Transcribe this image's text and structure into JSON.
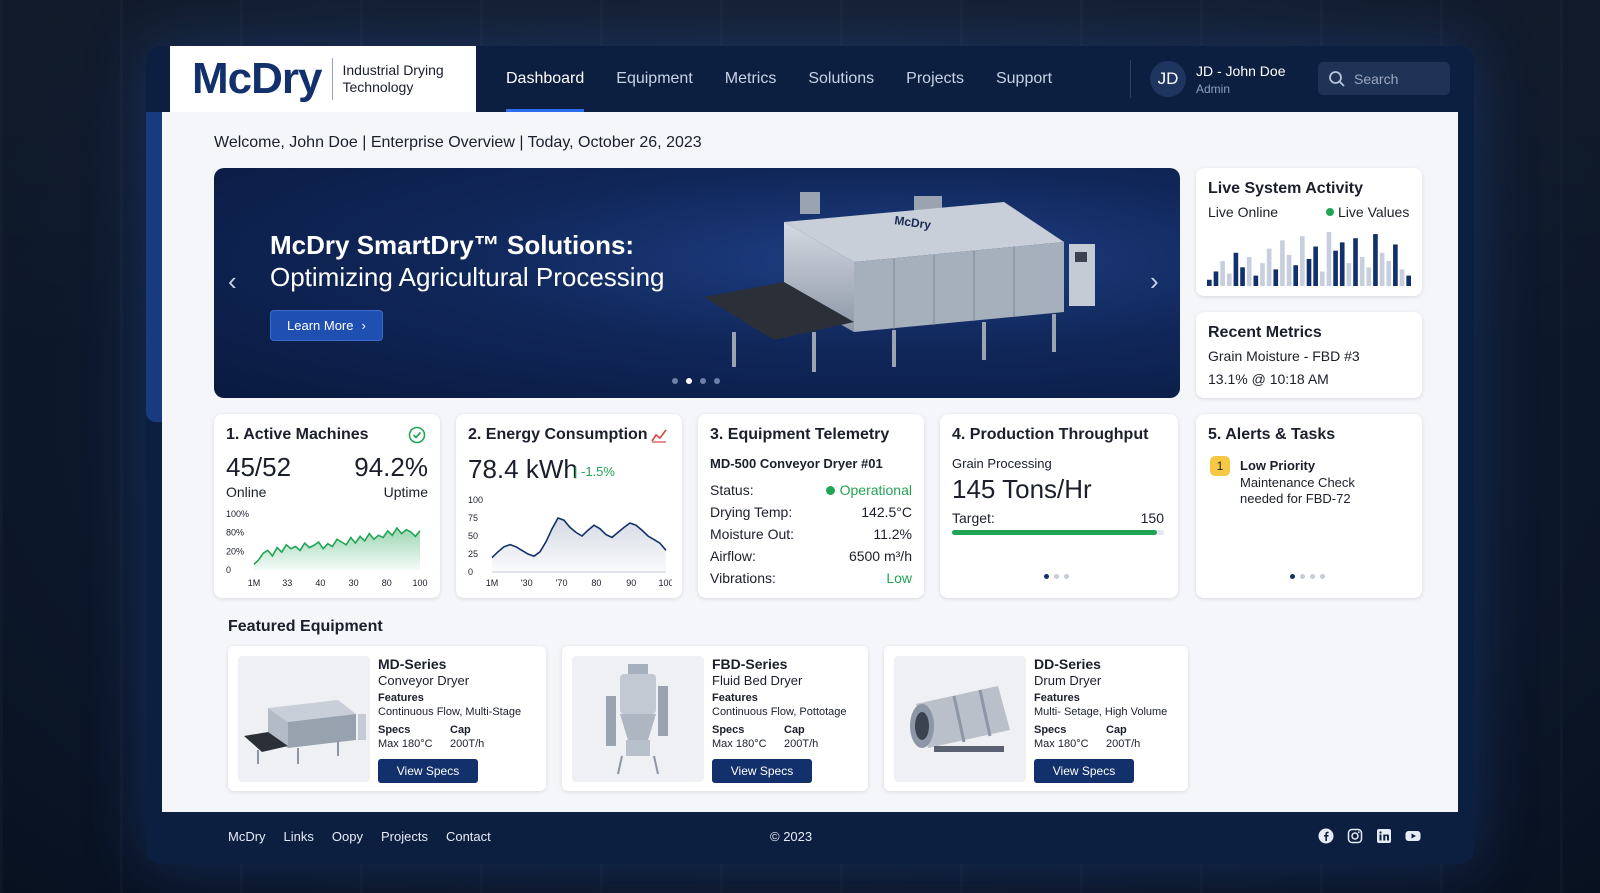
{
  "brand": {
    "logo": "McDry",
    "tagline_line1": "Industrial Drying",
    "tagline_line2": "Technology"
  },
  "nav": {
    "items": [
      {
        "label": "Dashboard",
        "active": true
      },
      {
        "label": "Equipment"
      },
      {
        "label": "Metrics"
      },
      {
        "label": "Solutions"
      },
      {
        "label": "Projects"
      },
      {
        "label": "Support"
      }
    ]
  },
  "user": {
    "initials": "JD",
    "name": "JD - John Doe",
    "role": "Admin"
  },
  "search": {
    "placeholder": "Search"
  },
  "welcome": {
    "text": "Welcome, John Doe  |  Enterprise Overview  |  Today, October 26, 2023"
  },
  "hero": {
    "title": "McDry SmartDry™ Solutions:",
    "subtitle": "Optimizing Agricultural Processing",
    "cta": "Learn More",
    "machine_badge": "McDry",
    "slides": 4,
    "active_slide": 2
  },
  "live": {
    "title": "Live System Activity",
    "left_label": "Live Online",
    "right_label": "Live Values"
  },
  "recent": {
    "title": "Recent Metrics",
    "line1": "Grain Moisture - FBD #3",
    "line2": "13.1% @ 10:18 AM"
  },
  "active_machines": {
    "title": "1. Active Machines",
    "count": "45/52",
    "count_label": "Online",
    "uptime": "94.2%",
    "uptime_label": "Uptime"
  },
  "energy": {
    "title": "2. Energy Consumption",
    "value": "78.4 kWh",
    "delta": "| -1.5%"
  },
  "telemetry": {
    "title": "3. Equipment Telemetry",
    "machine": "MD-500 Conveyor Dryer #01",
    "rows": [
      {
        "k": "Status:",
        "v": "Operational"
      },
      {
        "k": "Drying Temp:",
        "v": "142.5°C"
      },
      {
        "k": "Moisture Out:",
        "v": "11.2%"
      },
      {
        "k": "Airflow:",
        "v": "6500 m³/h"
      },
      {
        "k": "Vibrations:",
        "v": "Low"
      }
    ]
  },
  "throughput": {
    "title": "4. Production Throughput",
    "sub": "Grain Processing",
    "value": "145 Tons/Hr",
    "target_label": "Target:",
    "target_value": "150",
    "progress": 0.967
  },
  "alerts": {
    "title": "5. Alerts & Tasks",
    "badge": "1",
    "priority": "Low Priority",
    "line1": "Maintenance Check",
    "line2": "needed for FBD-72"
  },
  "featured": {
    "title": "Featured Equipment",
    "items": [
      {
        "name": "MD-Series",
        "type": "Conveyor Dryer",
        "features_label": "Features",
        "features": "Continuous Flow, Multi-Stage",
        "specs_label": "Specs",
        "specs": "Max 180°C",
        "cap_label": "Cap",
        "cap": "200T/h",
        "button": "View Specs"
      },
      {
        "name": "FBD-Series",
        "type": "Fluid Bed Dryer",
        "features_label": "Features",
        "features": "Continuous Flow, Pottotage",
        "specs_label": "Specs",
        "specs": "Max 180°C",
        "cap_label": "Cap",
        "cap": "200T/h",
        "button": "View Specs"
      },
      {
        "name": "DD-Series",
        "type": "Drum Dryer",
        "features_label": "Features",
        "features": "Multi- Setage, High Volume",
        "specs_label": "Specs",
        "specs": "Max 180°C",
        "cap_label": "Cap",
        "cap": "200T/h",
        "button": "View Specs"
      }
    ]
  },
  "footer": {
    "links": [
      "McDry",
      "Links",
      "Oopy",
      "Projects",
      "Contact"
    ],
    "copyright": "© 2023",
    "social": [
      "facebook-icon",
      "instagram-icon",
      "linkedin-icon",
      "youtube-icon"
    ]
  },
  "colors": {
    "navy": "#0d1f40",
    "brand": "#12306b",
    "accent": "#2d6df0",
    "green": "#22a455",
    "red": "#d64545"
  },
  "chart_data": [
    {
      "type": "bar",
      "name": "live-activity",
      "values": [
        3,
        7,
        12,
        6,
        16,
        9,
        14,
        5,
        11,
        18,
        8,
        22,
        15,
        10,
        24,
        13,
        19,
        7,
        26,
        17,
        21,
        11,
        23,
        14,
        9,
        25,
        16,
        12,
        20,
        8,
        5
      ]
    },
    {
      "type": "area",
      "name": "active-machines",
      "x_ticks": [
        "1M",
        "33",
        "40",
        "30",
        "80",
        "100"
      ],
      "y_ticks": [
        "100%",
        "80%",
        "20%",
        "0"
      ],
      "values": [
        10,
        18,
        30,
        35,
        25,
        40,
        32,
        45,
        38,
        42,
        35,
        48,
        40,
        44,
        50,
        38,
        47,
        42,
        55,
        50,
        45,
        58,
        48,
        60,
        52,
        65,
        55,
        62,
        58,
        70,
        62,
        75,
        65,
        72,
        68,
        60,
        70
      ]
    },
    {
      "type": "line",
      "name": "energy",
      "x_ticks": [
        "1M",
        "'30",
        "'70",
        "80",
        "90",
        "100"
      ],
      "y_ticks": [
        "100",
        "75",
        "50",
        "25",
        "0"
      ],
      "ylim": [
        0,
        100
      ],
      "values": [
        20,
        28,
        35,
        38,
        35,
        30,
        25,
        22,
        28,
        42,
        60,
        75,
        72,
        62,
        55,
        50,
        58,
        65,
        60,
        52,
        48,
        55,
        62,
        68,
        65,
        58,
        50,
        45,
        40,
        30
      ]
    }
  ]
}
